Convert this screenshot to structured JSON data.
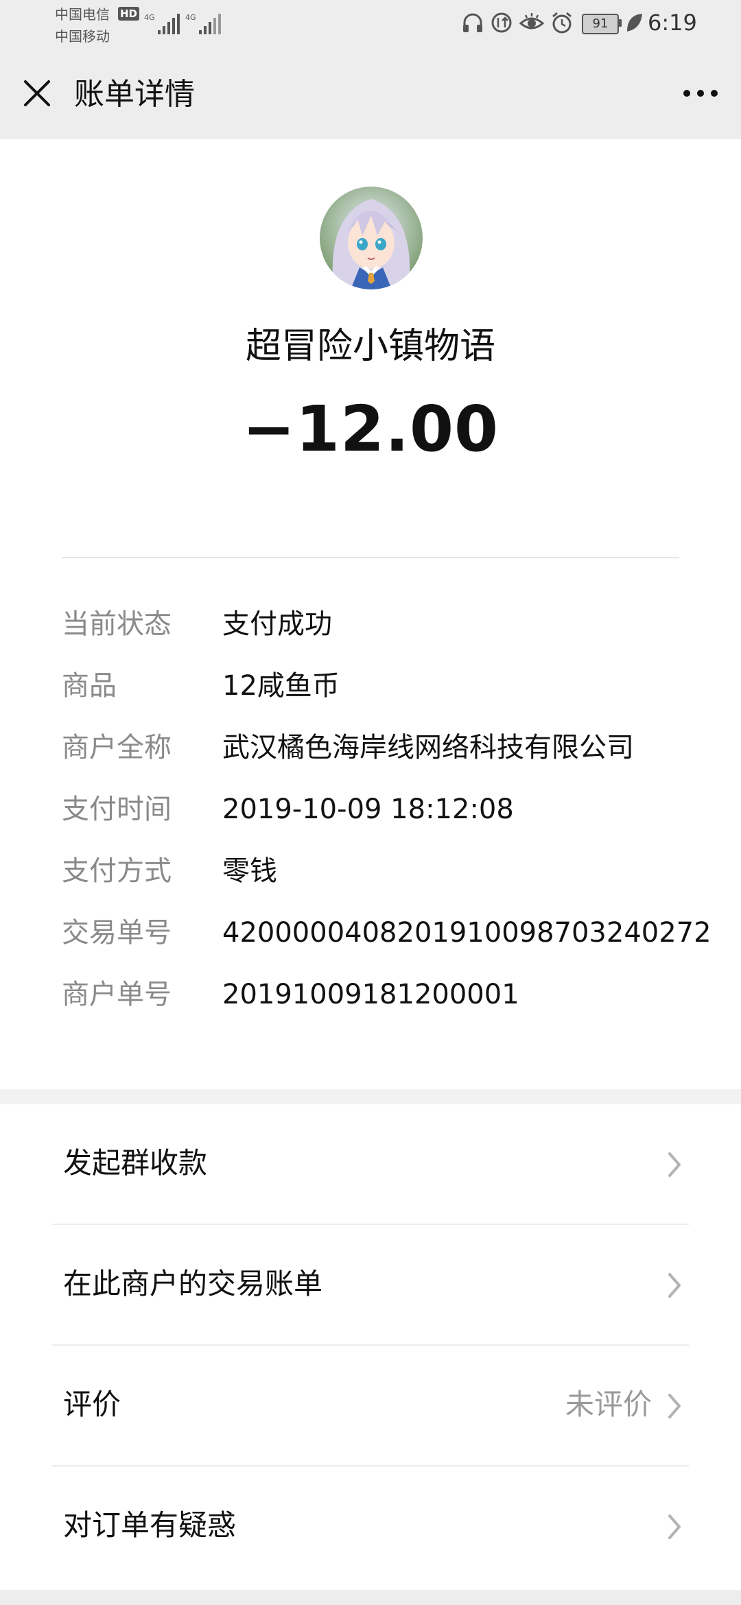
{
  "status_bar": {
    "carrier_1": "中国电信",
    "carrier_2": "中国移动",
    "hd_badge": "HD",
    "network_1": "4G",
    "network_2": "4G",
    "battery_level": "91",
    "time": "6:19",
    "icons": [
      "headset-icon",
      "data-saver-icon",
      "eye-comfort-icon",
      "alarm-icon",
      "battery-icon",
      "leaf-icon"
    ]
  },
  "nav": {
    "title": "账单详情",
    "close_icon": "close-icon",
    "more_icon": "more-icon"
  },
  "header": {
    "merchant_name": "超冒险小镇物语",
    "amount": "−12.00"
  },
  "details": [
    {
      "label": "当前状态",
      "value": "支付成功"
    },
    {
      "label": "商品",
      "value": "12咸鱼币"
    },
    {
      "label": "商户全称",
      "value": "武汉橘色海岸线网络科技有限公司"
    },
    {
      "label": "支付时间",
      "value": "2019-10-09 18:12:08"
    },
    {
      "label": "支付方式",
      "value": "零钱"
    },
    {
      "label": "交易单号",
      "value": "4200000408201910098703240272"
    },
    {
      "label": "商户单号",
      "value": "20191009181200001"
    }
  ],
  "menu": [
    {
      "label": "发起群收款",
      "value": ""
    },
    {
      "label": "在此商户的交易账单",
      "value": ""
    },
    {
      "label": "评价",
      "value": "未评价"
    },
    {
      "label": "对订单有疑惑",
      "value": ""
    }
  ],
  "colors": {
    "topbar_bg": "#ededed",
    "label_grey": "#8a8a8a",
    "text_dark": "#111111"
  }
}
